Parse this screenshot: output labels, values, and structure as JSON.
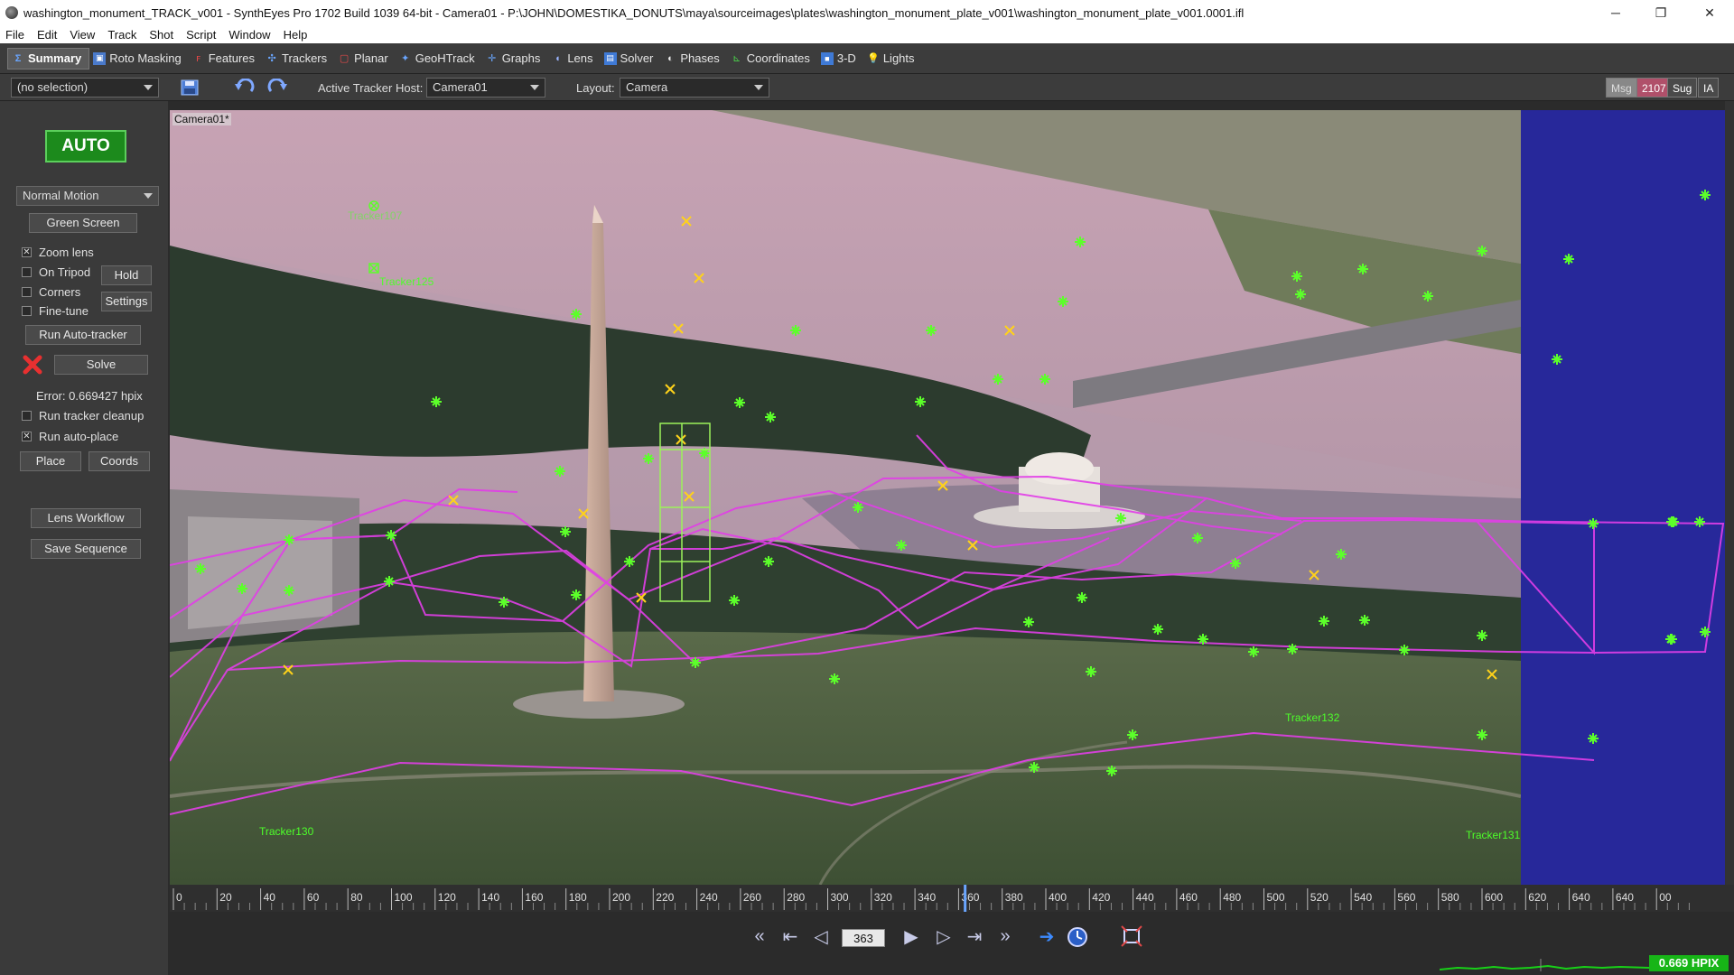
{
  "window": {
    "title": "washington_monument_TRACK_v001 - SynthEyes Pro 1702 Build 1039 64-bit - Camera01 - P:\\JOHN\\DOMESTIKA_DONUTS\\maya\\sourceimages\\plates\\washington_monument_plate_v001\\washington_monument_plate_v001.0001.ifl",
    "minimize": "─",
    "restore": "❐",
    "close": "✕"
  },
  "menu": [
    "File",
    "Edit",
    "View",
    "Track",
    "Shot",
    "Script",
    "Window",
    "Help"
  ],
  "rooms": [
    {
      "label": "Summary",
      "icon": "summary-icon",
      "active": true
    },
    {
      "label": "Roto Masking",
      "icon": "roto-icon"
    },
    {
      "label": "Features",
      "icon": "features-icon"
    },
    {
      "label": "Trackers",
      "icon": "trackers-icon"
    },
    {
      "label": "Planar",
      "icon": "planar-icon"
    },
    {
      "label": "GeoHTrack",
      "icon": "geohtrack-icon"
    },
    {
      "label": "Graphs",
      "icon": "graphs-icon"
    },
    {
      "label": "Lens",
      "icon": "lens-icon"
    },
    {
      "label": "Solver",
      "icon": "solver-icon"
    },
    {
      "label": "Phases",
      "icon": "phases-icon"
    },
    {
      "label": "Coordinates",
      "icon": "coordinates-icon"
    },
    {
      "label": "3-D",
      "icon": "3d-icon"
    },
    {
      "label": "Lights",
      "icon": "lights-icon"
    }
  ],
  "toolbar": {
    "selection": "(no selection)",
    "active_tracker_host_label": "Active Tracker Host:",
    "active_tracker_host": "Camera01",
    "layout_label": "Layout:",
    "layout": "Camera",
    "badges": [
      "Msg",
      "2107",
      "Sug",
      "IA"
    ]
  },
  "left_panel": {
    "auto": "AUTO",
    "motion": "Normal Motion",
    "green_screen": "Green Screen",
    "zoom_lens": "Zoom lens",
    "zoom_lens_checked": true,
    "on_tripod": "On Tripod",
    "on_tripod_checked": false,
    "corners": "Corners",
    "corners_checked": false,
    "fine_tune": "Fine-tune",
    "fine_tune_checked": false,
    "hold": "Hold",
    "settings": "Settings",
    "run_auto_tracker": "Run Auto-tracker",
    "solve": "Solve",
    "error": "Error: 0.669427 hpix",
    "run_tracker_cleanup": "Run tracker cleanup",
    "run_tracker_cleanup_checked": false,
    "run_auto_place": "Run auto-place",
    "run_auto_place_checked": true,
    "place": "Place",
    "coords": "Coords",
    "lens_workflow": "Lens Workflow",
    "save_sequence": "Save Sequence"
  },
  "viewport": {
    "camera_label": "Camera01*",
    "tracker_labels": [
      "Tracker107",
      "Tracker125",
      "Tracker130",
      "Tracker132",
      "Tracker131"
    ]
  },
  "timeline": {
    "ticks": [
      "0",
      "20",
      "40",
      "60",
      "80",
      "100",
      "120",
      "140",
      "160",
      "180",
      "200",
      "220",
      "240",
      "260",
      "280",
      "300",
      "320",
      "340",
      "360",
      "380",
      "400",
      "420",
      "440",
      "460",
      "480",
      "500",
      "520",
      "540",
      "560",
      "580",
      "600",
      "620",
      "640",
      "640",
      "00"
    ],
    "current_frame": "363"
  },
  "status": {
    "hpix": "0.669 HPIX"
  },
  "colors": {
    "tracker_green": "#5cff2a",
    "tracker_yellow": "#ffd21a",
    "mesh_magenta": "#e23ee8",
    "auto_green": "#1c8a1c"
  }
}
